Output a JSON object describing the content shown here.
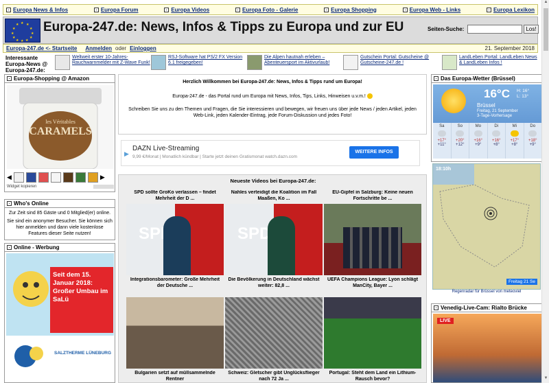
{
  "topnav": [
    "Europa News & Infos",
    "Europa Forum",
    "Europa Videos",
    "Europa Foto - Galerie",
    "Europa Shopping",
    "Europa Web - Links",
    "Europa Lexikon"
  ],
  "header": {
    "title": "Europa-247.de: News, Infos & Tipps zu Europa und zur EU",
    "search_label": "Seiten-Suche:",
    "search_button": "Los!"
  },
  "subnav": {
    "home": "Europa-247.de <- Startseite",
    "login": "Anmelden",
    "or": "oder",
    "register": "Einloggen",
    "date": "21. September 2018"
  },
  "ticker": {
    "label": "Interessante Europa-News @ Europa-247.de:",
    "items": [
      "Weltweit erster 10-Jahres-Rauchwarnmelder mit Z-Wave Funk!",
      "RSJ-Software hat PS/2 FX Version 6.1 freigegeben!",
      "Die Alpen hautnah erleben – Abenteuersport im Aktivurlaub!",
      "Gutschein Portal: Gutscheine @ Gutscheine-247.de !",
      "LandLeben Portal: LandLeben News & LandLeben Infos !"
    ]
  },
  "left": {
    "shop_head": "Europa-Shopping @ Amazon",
    "shop_foot": "Widget kopieren",
    "who_head": "Who's Online",
    "who_line1": "Zur Zeit sind 85 Gäste und 0 Mitglied(er) online.",
    "who_line2": "Sie sind ein anonymer Besucher. Sie können sich hier anmelden und dann viele kostenlose Features dieser Seite nutzen!",
    "ad_head": "Online - Werbung",
    "ad_text": "Seit dem 15. Januar 2018: Großer Umbau im SaLü",
    "ad_brand": "SALZTHERME LÜNEBURG"
  },
  "center": {
    "welcome_title": "Herzlich Willkommen bei Europa-247.de: News, Infos & Tipps rund um Europa!",
    "welcome_p1": "Europa-247.de - das Portal rund um Europa mit News, Infos, Tips, Links, Hinweisen u.v.m.!",
    "welcome_p2": "Schreiben Sie uns zu den Themen und Fragen, die Sie interessieren und bewegen, wir freuen uns über jede News / jeden Artikel, jeden Web-Link, jeden Kalender-Eintrag, jede Forum-Diskussion und jedes Foto!",
    "dazn_title": "DAZN Live-Streaming",
    "dazn_sub": "9,99 €/Monat | Monatlich kündbar | Starte jetzt deinen Gratismonat watch.dazn.com",
    "dazn_btn": "WEITERE INFOS",
    "videos_head": "Neueste Videos bei Europa-247.de:",
    "videos": [
      "SPD sollte GroKo verlassen – findet Mehrheit der D ...",
      "Nahles verteidigt die Koalition im Fall Maaßen, Ko ...",
      "EU-Gipfel in Salzburg: Keine neuen Fortschritte be ...",
      "Integrationsbarometer: Große Mehrheit der Deutsche ...",
      "Die Bevölkerung in Deutschland wächst weiter: 82,8 ...",
      "UEFA Champions League: Lyon schlägt ManCity, Bayer ...",
      "Bulgarien setzt auf müllsammelnde Rentner",
      "Schweiz: Gletscher gibt Unglücksflieger nach 72 Ja ...",
      "Portugal: Steht dem Land ein Lithium-Rausch bevor?"
    ]
  },
  "right": {
    "weather_head": "Das Europa-Wetter (Brüssel)",
    "temp": "16°C",
    "hi": "H: 16°",
    "lo": "L: 13°",
    "city": "Brüssel",
    "date": "Freitag, 21 September",
    "forecast_label": "3-Tage-Vorhersage",
    "days": [
      {
        "d": "Sa",
        "hi": "+17°",
        "lo": "+11°"
      },
      {
        "d": "So",
        "hi": "+20°",
        "lo": "+12°"
      },
      {
        "d": "Mo",
        "hi": "+16°",
        "lo": "+9°"
      },
      {
        "d": "Di",
        "hi": "+16°",
        "lo": "+8°"
      },
      {
        "d": "Mi",
        "hi": "+17°",
        "lo": "+8°"
      },
      {
        "d": "Do",
        "hi": "+18°",
        "lo": "+9°"
      }
    ],
    "map_time": "18:10h",
    "map_date": "Freitag 21 Se",
    "map_link": "Regenradar für Brüssel von meteoviel",
    "live_head": "Venedig-Live-Cam: Rialto Brücke",
    "live_badge": "LIVE"
  }
}
